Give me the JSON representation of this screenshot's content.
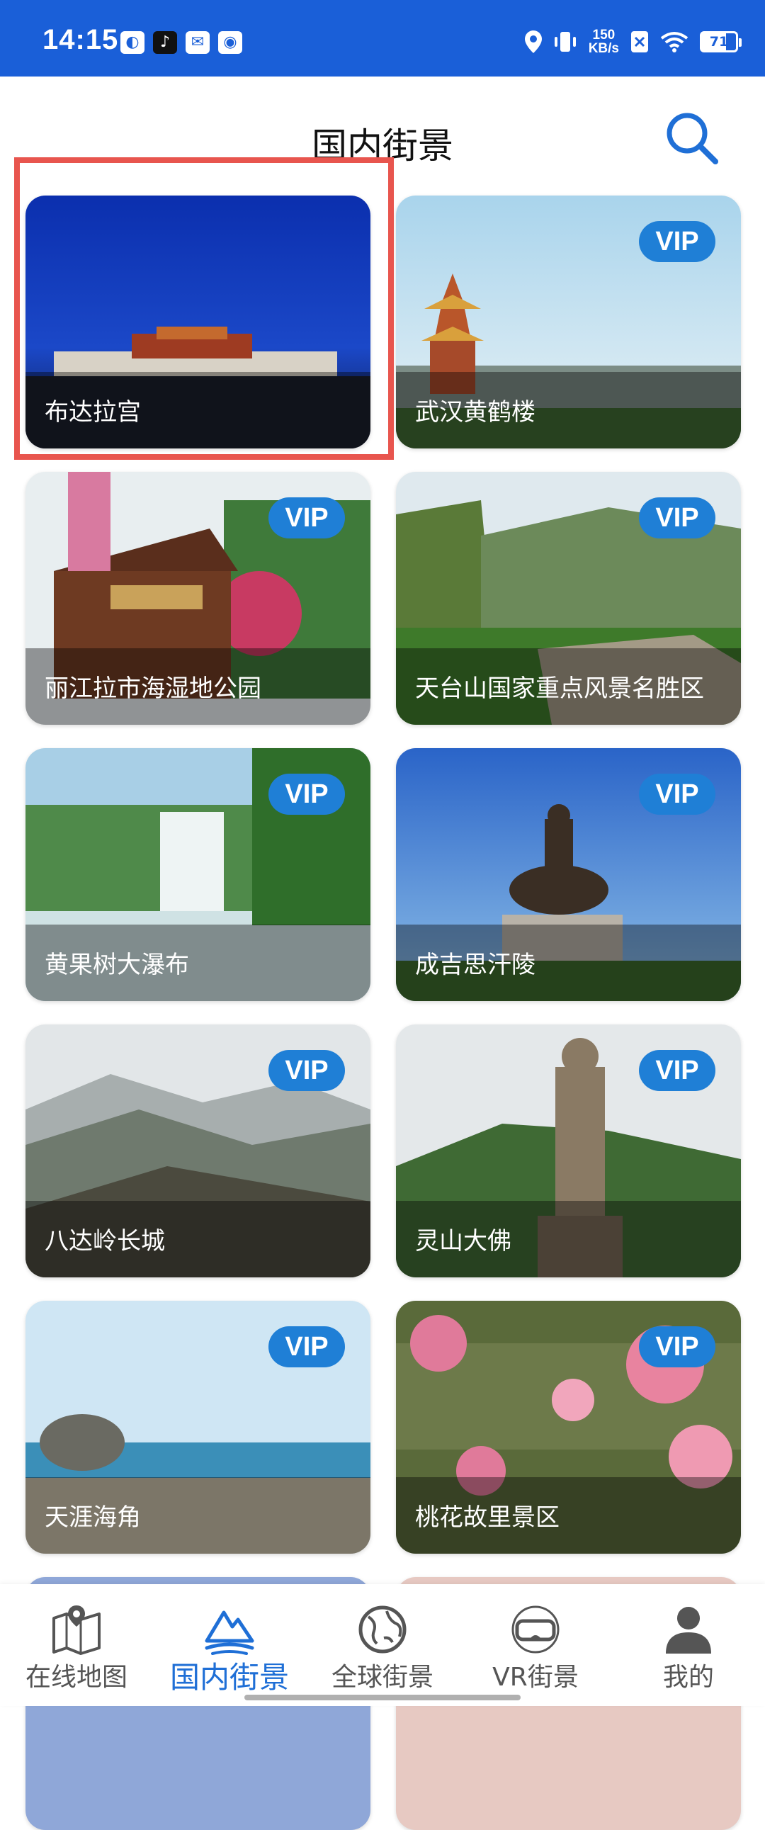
{
  "status_bar": {
    "time": "14:15",
    "net_speed_value": "150",
    "net_speed_unit": "KB/s",
    "battery": "71"
  },
  "header": {
    "title": "国内街景"
  },
  "cards": [
    {
      "label": "布达拉宫",
      "vip": false
    },
    {
      "label": "武汉黄鹤楼",
      "vip": true
    },
    {
      "label": "丽江拉市海湿地公园",
      "vip": true
    },
    {
      "label": "天台山国家重点风景名胜区",
      "vip": true
    },
    {
      "label": "黄果树大瀑布",
      "vip": true
    },
    {
      "label": "成吉思汗陵",
      "vip": true
    },
    {
      "label": "八达岭长城",
      "vip": true
    },
    {
      "label": "灵山大佛",
      "vip": true
    },
    {
      "label": "天涯海角",
      "vip": true
    },
    {
      "label": "桃花故里景区",
      "vip": true
    }
  ],
  "vip_label": "VIP",
  "bottom_nav": {
    "items": [
      {
        "label": "在线地图",
        "icon": "map-icon",
        "active": false
      },
      {
        "label": "国内街景",
        "icon": "mountain-icon",
        "active": true
      },
      {
        "label": "全球街景",
        "icon": "globe-icon",
        "active": false
      },
      {
        "label": "VR街景",
        "icon": "vr-headset-icon",
        "active": false
      },
      {
        "label": "我的",
        "icon": "person-icon",
        "active": false
      }
    ]
  },
  "colors": {
    "status_bar": "#1a5fd8",
    "accent": "#1f6fd6",
    "vip_badge": "#1f7fd6",
    "highlight": "#e8554e"
  }
}
